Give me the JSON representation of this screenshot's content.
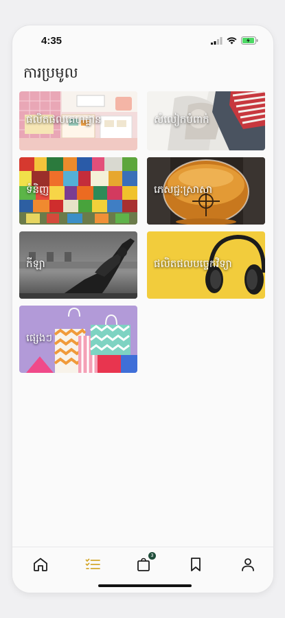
{
  "status_bar": {
    "time": "4:35"
  },
  "page": {
    "title": "ការប្រមូល"
  },
  "categories": [
    {
      "label": "ផលិតផលគេហដ្ឋាន"
    },
    {
      "label": "សំលៀកបំពាក់"
    },
    {
      "label": "ទំនិញ"
    },
    {
      "label": "ភេសជ្ជៈស្រាសា"
    },
    {
      "label": "កីឡា"
    },
    {
      "label": "ផលិតផលបច្ចេកវិទ្យា"
    },
    {
      "label": "ផ្សេងៗ"
    }
  ],
  "bottom_nav": {
    "items": [
      {
        "icon": "home-icon",
        "active": false
      },
      {
        "icon": "list-icon",
        "active": true
      },
      {
        "icon": "bag-icon",
        "active": false,
        "badge": "3"
      },
      {
        "icon": "bookmark-icon",
        "active": false
      },
      {
        "icon": "profile-icon",
        "active": false
      }
    ]
  },
  "colors": {
    "accent": "#d4a72c",
    "nav_icon": "#1b1b1b",
    "badge": "#1f4d3a"
  }
}
